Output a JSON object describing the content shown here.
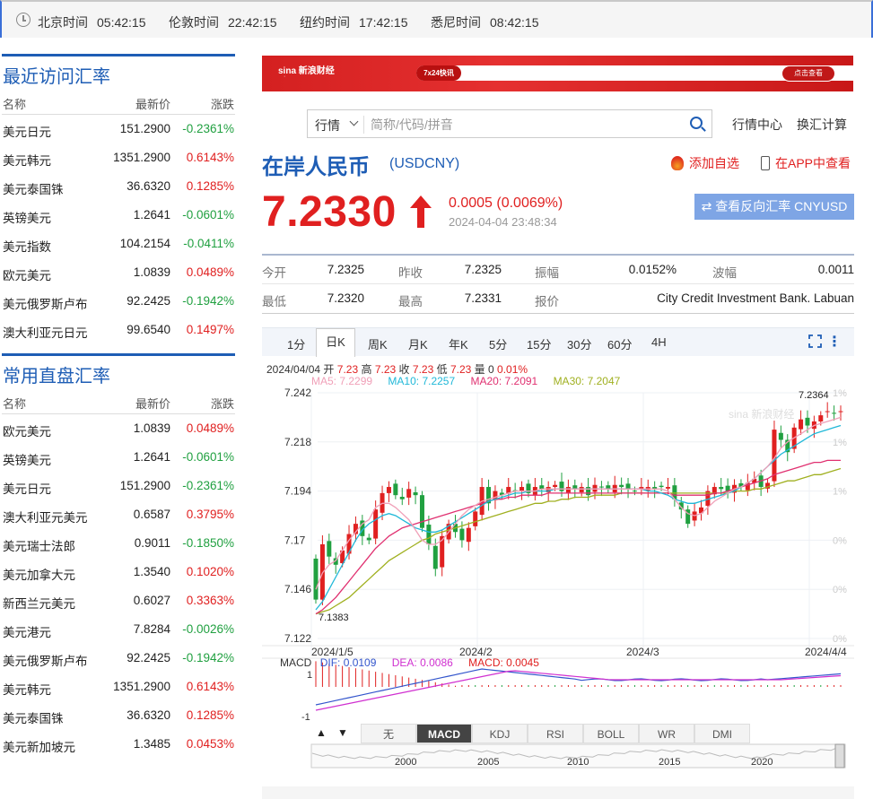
{
  "clocks": [
    {
      "label": "北京时间",
      "time": "05:42:15"
    },
    {
      "label": "伦敦时间",
      "time": "22:42:15"
    },
    {
      "label": "纽约时间",
      "time": "17:42:15"
    },
    {
      "label": "悉尼时间",
      "time": "08:42:15"
    }
  ],
  "recent": {
    "title": "最近访问汇率",
    "headers": [
      "名称",
      "最新价",
      "涨跌"
    ],
    "rows": [
      [
        "美元日元",
        "151.2900",
        "-0.2361%"
      ],
      [
        "美元韩元",
        "1351.2900",
        "0.6143%"
      ],
      [
        "美元泰国铢",
        "36.6320",
        "0.1285%"
      ],
      [
        "英镑美元",
        "1.2641",
        "-0.0601%"
      ],
      [
        "美元指数",
        "104.2154",
        "-0.0411%"
      ],
      [
        "欧元美元",
        "1.0839",
        "0.0489%"
      ],
      [
        "美元俄罗斯卢布",
        "92.2425",
        "-0.1942%"
      ],
      [
        "澳大利亚元日元",
        "99.6540",
        "0.1497%"
      ]
    ]
  },
  "direct": {
    "title": "常用直盘汇率",
    "headers": [
      "名称",
      "最新价",
      "涨跌"
    ],
    "rows": [
      [
        "欧元美元",
        "1.0839",
        "0.0489%"
      ],
      [
        "英镑美元",
        "1.2641",
        "-0.0601%"
      ],
      [
        "美元日元",
        "151.2900",
        "-0.2361%"
      ],
      [
        "澳大利亚元美元",
        "0.6587",
        "0.3795%"
      ],
      [
        "美元瑞士法郎",
        "0.9011",
        "-0.1850%"
      ],
      [
        "美元加拿大元",
        "1.3540",
        "0.1020%"
      ],
      [
        "新西兰元美元",
        "0.6027",
        "0.3363%"
      ],
      [
        "美元港元",
        "7.8284",
        "-0.0026%"
      ],
      [
        "美元俄罗斯卢布",
        "92.2425",
        "-0.1942%"
      ],
      [
        "美元韩元",
        "1351.2900",
        "0.6143%"
      ],
      [
        "美元泰国铢",
        "36.6320",
        "0.1285%"
      ],
      [
        "美元新加坡元",
        "1.3485",
        "0.0453%"
      ]
    ]
  },
  "banner": {
    "tag": "7x24快讯",
    "button": "点击查看"
  },
  "search": {
    "select": "行情",
    "placeholder": "简称/代码/拼音"
  },
  "links": {
    "center": "行情中心",
    "convert": "换汇计算"
  },
  "quote": {
    "name": "在岸人民币",
    "code": "(USDCNY)",
    "add_fav": "添加自选",
    "in_app": "在APP中查看",
    "price": "7.2330",
    "change": "0.0005 (0.0069%)",
    "time": "2024-04-04 23:48:34",
    "reverse": "⇄ 查看反向汇率 CNYUSD"
  },
  "stats": [
    [
      {
        "l": "今开",
        "v": "7.2325"
      },
      {
        "l": "昨收",
        "v": "7.2325"
      },
      {
        "l": "振幅",
        "v": "0.0152%"
      },
      {
        "l": "波幅",
        "v": "0.0011"
      }
    ],
    [
      {
        "l": "最低",
        "v": "7.2320"
      },
      {
        "l": "最高",
        "v": "7.2331"
      },
      {
        "l": "报价",
        "v": "City Credit Investment Bank. Labuan"
      }
    ]
  ],
  "periods": [
    "1分",
    "日K",
    "周K",
    "月K",
    "年K",
    "5分",
    "15分",
    "30分",
    "60分",
    "4H"
  ],
  "active_period": "日K",
  "ohlc": {
    "date": "2024/04/04",
    "open_l": "开",
    "open": "7.23",
    "high_l": "高",
    "high": "7.23",
    "close_l": "收",
    "close": "7.23",
    "low_l": "低",
    "low": "7.23",
    "vol_l": "量",
    "vol": "0",
    "pct": "0.01%"
  },
  "ma": [
    {
      "name": "MA5:",
      "value": "7.2299",
      "color": "#f0a0b8"
    },
    {
      "name": "MA10:",
      "value": "7.2257",
      "color": "#20b8d8"
    },
    {
      "name": "MA20:",
      "value": "7.2091",
      "color": "#e03070"
    },
    {
      "name": "MA30:",
      "value": "7.2047",
      "color": "#a0b020"
    }
  ],
  "chart_data": {
    "type": "candlestick",
    "y_ticks": [
      "7.242",
      "7.218",
      "7.194",
      "7.17",
      "7.146",
      "7.122"
    ],
    "right_ticks": [
      "1%",
      "1%",
      "1%",
      "0%",
      "0%",
      "0%"
    ],
    "x_ticks": [
      "2024/1/5",
      "2024/2",
      "2024/3",
      "2024/4/4"
    ],
    "max_label": "7.2364",
    "min_label": "7.1383",
    "ylim": [
      7.122,
      7.242
    ],
    "up_color": "#e02020",
    "down_color": "#20a040",
    "closes": [
      7.141,
      7.168,
      7.162,
      7.158,
      7.165,
      7.173,
      7.178,
      7.172,
      7.17,
      7.185,
      7.193,
      7.196,
      7.192,
      7.19,
      7.195,
      7.192,
      7.176,
      7.168,
      7.156,
      7.172,
      7.178,
      7.174,
      7.17,
      7.176,
      7.184,
      7.196,
      7.188,
      7.194,
      7.192,
      7.196,
      7.194,
      7.196,
      7.193,
      7.196,
      7.195,
      7.196,
      7.197,
      7.194,
      7.196,
      7.195,
      7.196,
      7.192,
      7.197,
      7.196,
      7.195,
      7.197,
      7.196,
      7.195,
      7.194,
      7.196,
      7.196,
      7.195,
      7.196,
      7.196,
      7.19,
      7.185,
      7.178,
      7.184,
      7.186,
      7.194,
      7.196,
      7.195,
      7.194,
      7.197,
      7.196,
      7.198,
      7.2,
      7.196,
      7.198,
      7.224,
      7.219,
      7.213,
      7.225,
      7.229,
      7.226,
      7.228,
      7.231,
      7.233,
      7.232,
      7.233
    ],
    "ma5": [
      7.146,
      7.154,
      7.158,
      7.16,
      7.165,
      7.17,
      7.174,
      7.178,
      7.18,
      7.186,
      7.188,
      7.188,
      7.186,
      7.183,
      7.18,
      7.175,
      7.17,
      7.168,
      7.168,
      7.17,
      7.174,
      7.178,
      7.182,
      7.185,
      7.187,
      7.189,
      7.19,
      7.191,
      7.192,
      7.193,
      7.194,
      7.194,
      7.194,
      7.194,
      7.195,
      7.195,
      7.195,
      7.195,
      7.195,
      7.195,
      7.195,
      7.195,
      7.195,
      7.195,
      7.195,
      7.195,
      7.195,
      7.195,
      7.195,
      7.195,
      7.195,
      7.195,
      7.195,
      7.194,
      7.19,
      7.186,
      7.183,
      7.182,
      7.183,
      7.186,
      7.189,
      7.191,
      7.193,
      7.195,
      7.196,
      7.198,
      7.2,
      7.203,
      7.206,
      7.21,
      7.215,
      7.218,
      7.22,
      7.222,
      7.224,
      7.226,
      7.227,
      7.228,
      7.229,
      7.23
    ],
    "ma10": [
      7.136,
      7.14,
      7.146,
      7.152,
      7.158,
      7.164,
      7.17,
      7.175,
      7.178,
      7.18,
      7.182,
      7.183,
      7.182,
      7.18,
      7.178,
      7.176,
      7.175,
      7.174,
      7.174,
      7.175,
      7.177,
      7.179,
      7.181,
      7.183,
      7.185,
      7.187,
      7.189,
      7.19,
      7.191,
      7.192,
      7.193,
      7.193,
      7.194,
      7.194,
      7.194,
      7.194,
      7.195,
      7.195,
      7.195,
      7.195,
      7.195,
      7.195,
      7.195,
      7.195,
      7.195,
      7.195,
      7.195,
      7.195,
      7.195,
      7.195,
      7.194,
      7.194,
      7.193,
      7.192,
      7.19,
      7.189,
      7.188,
      7.188,
      7.189,
      7.19,
      7.191,
      7.192,
      7.193,
      7.194,
      7.196,
      7.198,
      7.2,
      7.203,
      7.206,
      7.209,
      7.212,
      7.214,
      7.216,
      7.218,
      7.22,
      7.222,
      7.223,
      7.224,
      7.225,
      7.226
    ],
    "ma20": [
      7.134,
      7.136,
      7.139,
      7.142,
      7.146,
      7.15,
      7.154,
      7.158,
      7.162,
      7.166,
      7.169,
      7.172,
      7.174,
      7.176,
      7.177,
      7.178,
      7.179,
      7.18,
      7.181,
      7.182,
      7.183,
      7.184,
      7.185,
      7.186,
      7.187,
      7.188,
      7.189,
      7.19,
      7.19,
      7.191,
      7.191,
      7.192,
      7.192,
      7.192,
      7.192,
      7.193,
      7.193,
      7.193,
      7.193,
      7.193,
      7.193,
      7.193,
      7.193,
      7.193,
      7.193,
      7.193,
      7.193,
      7.193,
      7.193,
      7.193,
      7.193,
      7.193,
      7.193,
      7.193,
      7.192,
      7.192,
      7.192,
      7.192,
      7.192,
      7.192,
      7.193,
      7.193,
      7.194,
      7.195,
      7.196,
      7.197,
      7.198,
      7.199,
      7.2,
      7.202,
      7.203,
      7.204,
      7.205,
      7.206,
      7.207,
      7.208,
      7.208,
      7.209,
      7.209,
      7.209
    ],
    "ma30": [
      7.134,
      7.135,
      7.136,
      7.138,
      7.14,
      7.142,
      7.145,
      7.148,
      7.151,
      7.154,
      7.157,
      7.16,
      7.162,
      7.164,
      7.166,
      7.168,
      7.17,
      7.171,
      7.173,
      7.174,
      7.175,
      7.176,
      7.177,
      7.178,
      7.179,
      7.18,
      7.181,
      7.182,
      7.183,
      7.184,
      7.185,
      7.186,
      7.187,
      7.188,
      7.188,
      7.189,
      7.189,
      7.19,
      7.19,
      7.191,
      7.191,
      7.191,
      7.192,
      7.192,
      7.192,
      7.192,
      7.193,
      7.193,
      7.193,
      7.193,
      7.193,
      7.193,
      7.193,
      7.193,
      7.193,
      7.193,
      7.193,
      7.193,
      7.193,
      7.193,
      7.193,
      7.193,
      7.193,
      7.194,
      7.194,
      7.194,
      7.195,
      7.195,
      7.196,
      7.197,
      7.198,
      7.199,
      7.199,
      7.2,
      7.201,
      7.202,
      7.202,
      7.203,
      7.204,
      7.205
    ]
  },
  "macd": {
    "title": "MACD",
    "dif_l": "DIF:",
    "dif": "0.0109",
    "dea_l": "DEA:",
    "dea": "0.0086",
    "macd_l": "MACD:",
    "macd": "0.0045",
    "ticks": [
      "1",
      "-1"
    ]
  },
  "indicators": [
    "无",
    "MACD",
    "KDJ",
    "RSI",
    "BOLL",
    "WR",
    "DMI"
  ],
  "active_indicator": "MACD",
  "timeline": [
    "2000",
    "2005",
    "2010",
    "2015",
    "2020"
  ],
  "nav": {
    "up": "▲",
    "down": "▼"
  }
}
